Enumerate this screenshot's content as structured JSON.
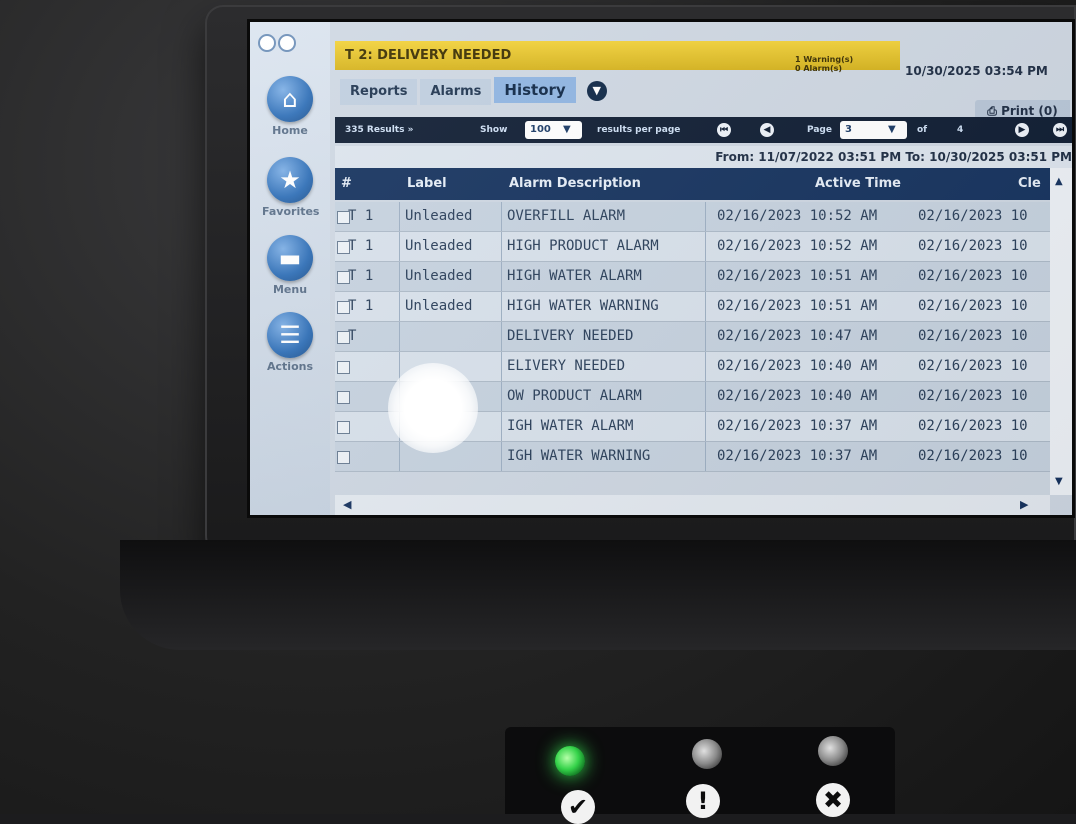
{
  "window": {
    "alarm_banner": "T 2: DELIVERY NEEDED",
    "warning_count": "1 Warning(s)",
    "alarm_count": "0 Alarm(s)",
    "datetime": "10/30/2025 03:54 PM"
  },
  "sidebar": {
    "items": [
      {
        "label": "Home",
        "icon": "home-icon"
      },
      {
        "label": "Favorites",
        "icon": "star-icon"
      },
      {
        "label": "Menu",
        "icon": "menu-icon"
      },
      {
        "label": "Actions",
        "icon": "actions-icon"
      }
    ]
  },
  "breadcrumb": {
    "items": [
      "Reports",
      "Alarms",
      "History"
    ]
  },
  "print_button": "Print (0)",
  "toolbar": {
    "results": "335 Results »",
    "show_label": "Show",
    "per_page_value": "100",
    "per_page_label": "results per page",
    "page_label": "Page",
    "page_value": "3",
    "of_label": "of",
    "total_pages": "4"
  },
  "date_range": "From: 11/07/2022 03:51 PM   To: 10/30/2025 03:51 PM",
  "table": {
    "headers": [
      "#",
      "Label",
      "Alarm Description",
      "Active Time",
      "Cle"
    ],
    "rows": [
      {
        "tank": "T 1",
        "label": "Unleaded",
        "desc": "OVERFILL ALARM",
        "active": "02/16/2023 10:52 AM",
        "cleared": "02/16/2023 10"
      },
      {
        "tank": "T 1",
        "label": "Unleaded",
        "desc": "HIGH PRODUCT ALARM",
        "active": "02/16/2023 10:52 AM",
        "cleared": "02/16/2023 10"
      },
      {
        "tank": "T 1",
        "label": "Unleaded",
        "desc": "HIGH WATER ALARM",
        "active": "02/16/2023 10:51 AM",
        "cleared": "02/16/2023 10"
      },
      {
        "tank": "T 1",
        "label": "Unleaded",
        "desc": "HIGH WATER WARNING",
        "active": "02/16/2023 10:51 AM",
        "cleared": "02/16/2023 10"
      },
      {
        "tank": "T",
        "label": "",
        "desc": "DELIVERY NEEDED",
        "active": "02/16/2023 10:47 AM",
        "cleared": "02/16/2023 10"
      },
      {
        "tank": "",
        "label": "",
        "desc": "ELIVERY NEEDED",
        "active": "02/16/2023 10:40 AM",
        "cleared": "02/16/2023 10"
      },
      {
        "tank": "",
        "label": "",
        "desc": "OW PRODUCT ALARM",
        "active": "02/16/2023 10:40 AM",
        "cleared": "02/16/2023 10"
      },
      {
        "tank": "",
        "label": "",
        "desc": "IGH WATER ALARM",
        "active": "02/16/2023 10:37 AM",
        "cleared": "02/16/2023 10"
      },
      {
        "tank": "",
        "label": "",
        "desc": "IGH WATER WARNING",
        "active": "02/16/2023 10:37 AM",
        "cleared": "02/16/2023 10"
      }
    ]
  },
  "indicators": {
    "power_led_color": "#35d34a",
    "warning_led_color": "#8a8a8a",
    "alarm_led_color": "#8a8a8a",
    "power_symbol": "✔",
    "warning_symbol": "!",
    "alarm_symbol": "✖"
  }
}
